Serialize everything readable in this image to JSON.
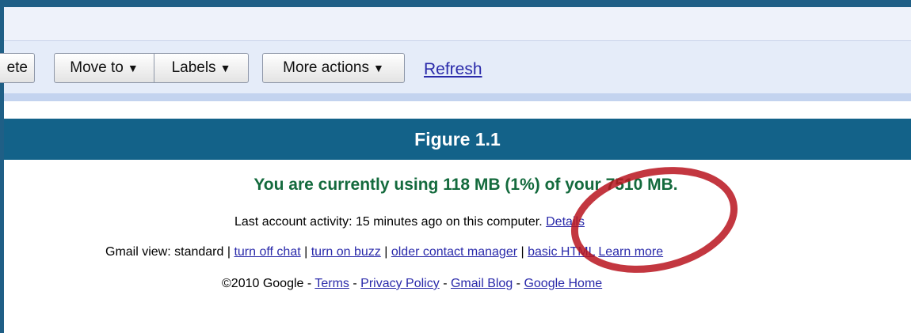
{
  "toolbar": {
    "delete_label": "ete",
    "move_to_label": "Move to",
    "labels_label": "Labels",
    "more_actions_label": "More actions",
    "caret": "▼",
    "refresh_label": "Refresh"
  },
  "figure": {
    "caption": "Figure 1.1"
  },
  "storage": {
    "text": "You are currently using 118 MB (1%) of your 7510 MB."
  },
  "activity": {
    "text": "Last account activity: 15 minutes ago on this computer.",
    "details_link": "Details"
  },
  "views": {
    "prefix": "Gmail view: standard",
    "sep": "|",
    "links": [
      "turn off chat",
      "turn on buzz",
      "older contact manager",
      "basic HTML",
      "Learn more"
    ]
  },
  "footer": {
    "copyright": "©2010 Google",
    "dash": "-",
    "links": [
      "Terms",
      "Privacy Policy",
      "Gmail Blog",
      "Google Home"
    ]
  },
  "colors": {
    "frame": "#1f5f86",
    "banner": "#136289",
    "storage_text": "#146a3d",
    "link": "#2a2aaa",
    "highlight_ellipse": "#b8141f"
  }
}
